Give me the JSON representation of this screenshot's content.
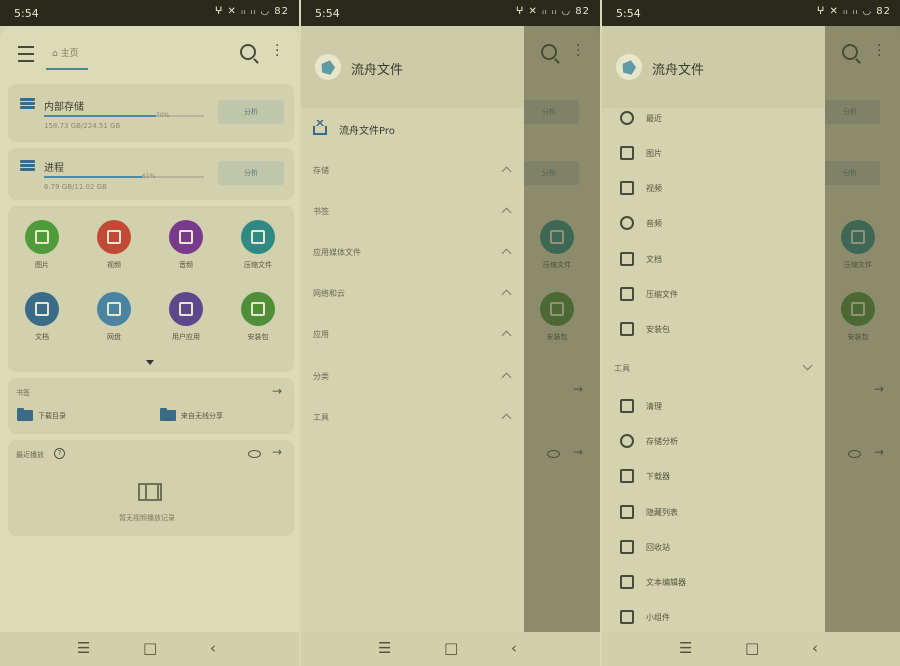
{
  "status": {
    "time": "5:54",
    "icons_text": "ⵖ ✕ ᵢₗ ᵢₗ ◡ 82"
  },
  "nav": {
    "menu": "☰",
    "home": "□",
    "back": "‹"
  },
  "panel1": {
    "tab_home": "主页",
    "storage": [
      {
        "name": "内部存储",
        "percent": "70%",
        "size": "158.73 GB/224.51 GB",
        "button": "分析"
      },
      {
        "name": "进程",
        "percent": "61%",
        "size": "6.79 GB/11.02 GB",
        "button": "分析"
      }
    ],
    "categories": [
      {
        "label": "图片",
        "color": "#4f9b3a"
      },
      {
        "label": "视频",
        "color": "#c04a36"
      },
      {
        "label": "音频",
        "color": "#7a3a8c"
      },
      {
        "label": "压缩文件",
        "color": "#2f8a86"
      },
      {
        "label": "文档",
        "color": "#3a6c8a"
      },
      {
        "label": "网盘",
        "color": "#4a84a0"
      },
      {
        "label": "用户应用",
        "color": "#5a4a8c"
      },
      {
        "label": "安装包",
        "color": "#4f8f3a"
      }
    ],
    "bookmarks": {
      "title": "书签",
      "items": [
        "下载目录",
        "来自无线分享"
      ]
    },
    "recent": {
      "title": "最近播放",
      "empty": "暂无视频播放记录"
    }
  },
  "panel2": {
    "app_name": "流舟文件",
    "pro": "流舟文件Pro",
    "groups": [
      "存储",
      "书签",
      "应用媒体文件",
      "网络和云",
      "应用",
      "分类",
      "工具"
    ]
  },
  "panel3": {
    "app_name": "流舟文件",
    "categories": [
      "最近",
      "图片",
      "视频",
      "音频",
      "文档",
      "压缩文件",
      "安装包"
    ],
    "tools_title": "工具",
    "tools": [
      "清理",
      "存储分析",
      "下载器",
      "隐藏列表",
      "回收站",
      "文本编辑器",
      "小组件"
    ]
  },
  "colors": {
    "accent": "#3a6c8a",
    "background": "#dcdbb8"
  }
}
